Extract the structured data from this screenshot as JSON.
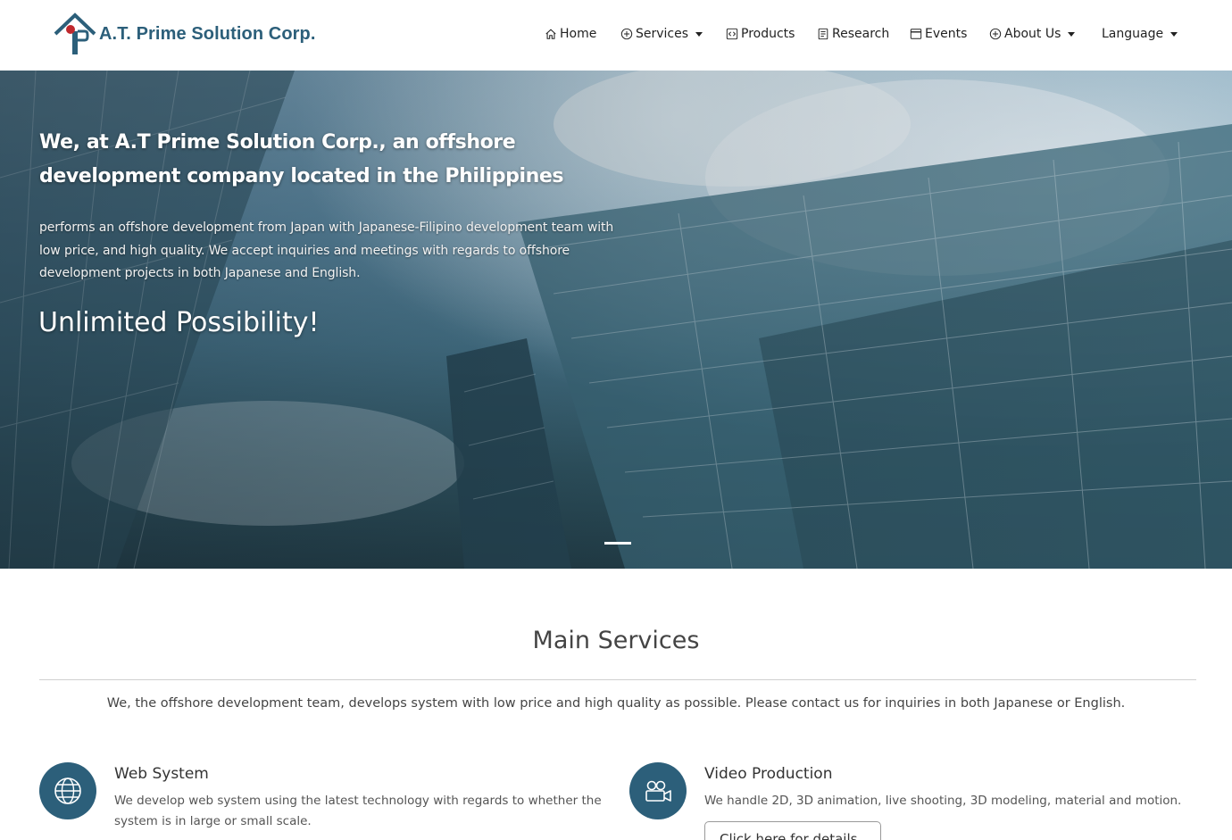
{
  "brand": {
    "name": "A.T. Prime Solution Corp."
  },
  "nav": {
    "home": "Home",
    "services": "Services",
    "products": "Products",
    "research": "Research",
    "events": "Events",
    "about": "About Us",
    "language": "Language"
  },
  "hero": {
    "title": "We, at A.T Prime Solution Corp., an offshore development company located in the Philippines",
    "description": "performs an offshore development from Japan with Japanese-Filipino development team with low price, and high quality. We accept inquiries and meetings with regards to offshore development projects in both Japanese and English.",
    "tagline": "Unlimited Possibility!"
  },
  "main_services": {
    "title": "Main Services",
    "description": "We, the offshore development team, develops system with low price and high quality as possible. Please contact us for inquiries in both Japanese or English.",
    "items": [
      {
        "title": "Web System",
        "text": "We develop web system using the latest technology with regards to whether the system is in large or small scale.",
        "icon": "globe-icon"
      },
      {
        "title": "Video Production",
        "text": "We handle 2D, 3D animation, live shooting, 3D modeling, material and motion.",
        "icon": "video-camera-icon",
        "button": "Click here for details"
      }
    ]
  },
  "colors": {
    "brand": "#2c5f7a",
    "accent_red": "#c0282d"
  }
}
